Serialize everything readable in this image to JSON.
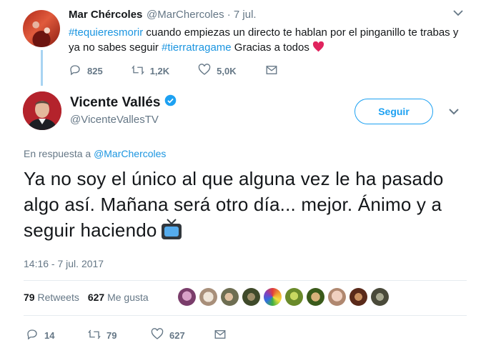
{
  "original_tweet": {
    "author_name": "Mar Chércoles",
    "meta": "@MarChercoles · 7 jul.",
    "text_parts": [
      {
        "type": "hashtag",
        "text": "#tequieresmorir"
      },
      {
        "type": "text",
        "text": " cuando empiezas un directo te hablan por el pinganillo te trabas y ya no sabes seguir "
      },
      {
        "type": "hashtag",
        "text": "#tierratragame"
      },
      {
        "type": "text",
        "text": " Gracias a todos "
      }
    ],
    "actions": {
      "replies": "825",
      "retweets": "1,2K",
      "likes": "5,0K"
    }
  },
  "main_tweet": {
    "author_name": "Vicente Vallés",
    "handle": "@VicenteVallesTV",
    "follow_label": "Seguir",
    "reply_prefix": "En respuesta a ",
    "reply_handle": "@MarChercoles",
    "text": "Ya no soy el único al que alguna vez le ha pasado algo así. Mañana será otro día... mejor. Ánimo y a seguir haciendo",
    "timestamp": "14:16 - 7 jul. 2017",
    "stats": {
      "retweets_count": "79",
      "retweets_label": "Retweets",
      "likes_count": "627",
      "likes_label": "Me gusta"
    },
    "liker_avatars": 10,
    "actions": {
      "replies": "14",
      "retweets": "79",
      "likes": "627"
    }
  },
  "colors": {
    "accent": "#1da1f2",
    "link": "#1b95e0",
    "muted": "#657786",
    "heart": "#e0245e"
  }
}
